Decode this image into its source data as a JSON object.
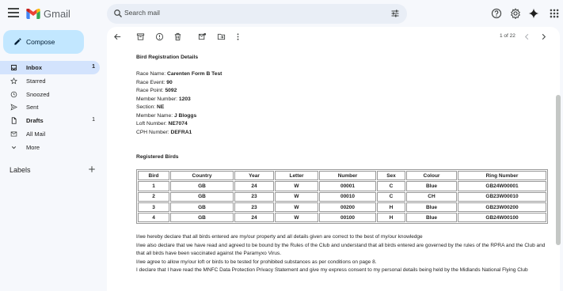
{
  "app": {
    "name": "Gmail"
  },
  "search": {
    "placeholder": "Search mail"
  },
  "compose": {
    "label": "Compose"
  },
  "sidebar": {
    "items": [
      {
        "label": "Inbox",
        "count": "1"
      },
      {
        "label": "Starred",
        "count": ""
      },
      {
        "label": "Snoozed",
        "count": ""
      },
      {
        "label": "Sent",
        "count": ""
      },
      {
        "label": "Drafts",
        "count": "1"
      },
      {
        "label": "All Mail",
        "count": ""
      },
      {
        "label": "More",
        "count": ""
      }
    ],
    "labels_heading": "Labels"
  },
  "toolbar": {
    "pager": "1 of 22"
  },
  "email": {
    "heading": "Bird Registration Details",
    "fields": [
      {
        "label": "Race Name:",
        "value": "Carenten Form B Test"
      },
      {
        "label": "Race Event:",
        "value": "90"
      },
      {
        "label": "Race Point:",
        "value": "5092"
      },
      {
        "label": "Member Number:",
        "value": "1203"
      },
      {
        "label": "Section:",
        "value": "NE"
      },
      {
        "label": "Member Name:",
        "value": "J Bloggs"
      },
      {
        "label": "Loft Number:",
        "value": "NE7074"
      },
      {
        "label": "CPH Number:",
        "value": "DEFRA1"
      }
    ],
    "registered_heading": "Registered Birds",
    "table": {
      "headers": [
        "Bird",
        "Country",
        "Year",
        "Letter",
        "Number",
        "Sex",
        "Colour",
        "Ring Number"
      ],
      "rows": [
        [
          "1",
          "GB",
          "24",
          "W",
          "00001",
          "C",
          "Blue",
          "GB24W00001"
        ],
        [
          "2",
          "GB",
          "23",
          "W",
          "00010",
          "C",
          "CH",
          "GB23W00010"
        ],
        [
          "3",
          "GB",
          "23",
          "W",
          "00200",
          "H",
          "Blue",
          "GB23W00200"
        ],
        [
          "4",
          "GB",
          "24",
          "W",
          "00100",
          "H",
          "Blue",
          "GB24W00100"
        ]
      ]
    },
    "declarations": [
      "I/we hereby declare that all birds entered are my/our property and all details given are correct to the best of my/our knowledge",
      "I/we also declare that we have read and agreed to be bound by the Rules of the Club and understand that all birds entered are governed by the rules of the RPRA and the Club and that all birds have been vaccinated against the Paramyxo Virus.",
      "I/we agree to allow my/our loft or birds to be tested for prohibited substances as per conditions on page 8.",
      "I declare that I have read the MNFC Data Protection Privacy Statement and give my express consent to my personal details being held by the Midlands National Flying Club"
    ]
  },
  "colors": {
    "accent": "#c2e7ff",
    "active_nav": "#d3e3fd",
    "background": "#f6f8fc"
  }
}
